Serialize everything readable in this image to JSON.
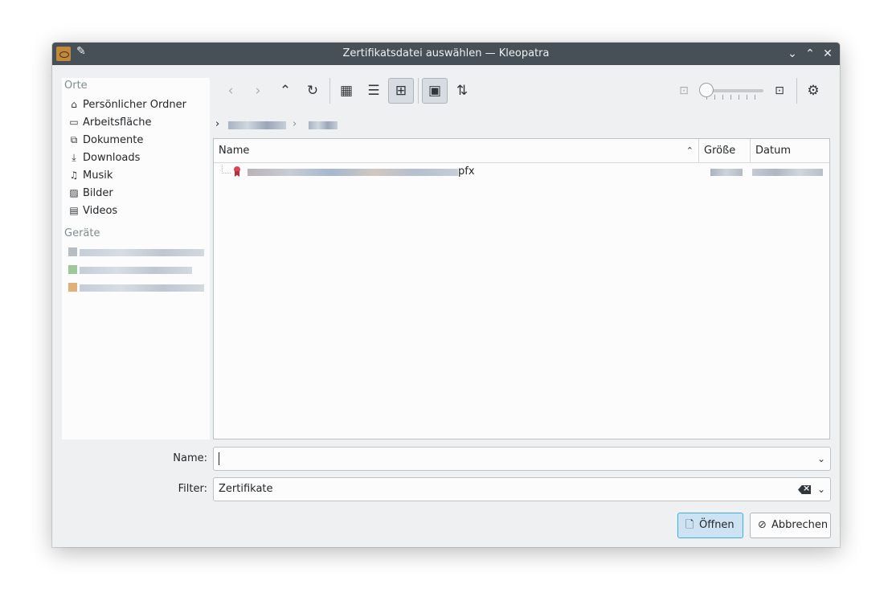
{
  "window": {
    "title": "Zertifikatsdatei auswählen — Kleopatra",
    "controls": {
      "minimize": "⌄",
      "maximize": "⌃",
      "close": "✕"
    }
  },
  "sidebar": {
    "places_header": "Orte",
    "places": [
      {
        "label": "Persönlicher Ordner",
        "icon": "home-icon",
        "glyph": "⌂"
      },
      {
        "label": "Arbeitsfläche",
        "icon": "desktop-icon",
        "glyph": "▭"
      },
      {
        "label": "Dokumente",
        "icon": "documents-icon",
        "glyph": "⧉"
      },
      {
        "label": "Downloads",
        "icon": "download-icon",
        "glyph": "⤓"
      },
      {
        "label": "Musik",
        "icon": "music-icon",
        "glyph": "♫"
      },
      {
        "label": "Bilder",
        "icon": "pictures-icon",
        "glyph": "▨"
      },
      {
        "label": "Videos",
        "icon": "video-icon",
        "glyph": "▤"
      }
    ],
    "devices_header": "Geräte"
  },
  "toolbar": {
    "buttons": [
      {
        "name": "back-button",
        "glyph": "‹",
        "enabled": false
      },
      {
        "name": "forward-button",
        "glyph": "›",
        "enabled": false
      },
      {
        "name": "parent-folder-button",
        "glyph": "⌃",
        "enabled": true
      },
      {
        "name": "reload-button",
        "glyph": "↻",
        "enabled": true
      },
      {
        "name": "icon-view-button",
        "glyph": "▦",
        "enabled": true
      },
      {
        "name": "compact-view-button",
        "glyph": "☰",
        "enabled": true
      },
      {
        "name": "tree-view-button",
        "glyph": "⊞",
        "enabled": true,
        "active": true
      },
      {
        "name": "preview-button",
        "glyph": "▣",
        "enabled": true,
        "active": true
      },
      {
        "name": "sort-button",
        "glyph": "⇅",
        "enabled": true
      }
    ],
    "zoom_level": 0,
    "options_glyph": "⚙"
  },
  "breadcrumb": {
    "separator": "›"
  },
  "file_list": {
    "columns": [
      "Name",
      "Größe",
      "Datum"
    ],
    "sort_indicator": "⌃",
    "rows": [
      {
        "name_suffix": "pfx"
      }
    ]
  },
  "form": {
    "name_label": "Name:",
    "name_value": "",
    "filter_label": "Filter:",
    "filter_value": "Zertifikate"
  },
  "buttons": {
    "open": "Öffnen",
    "cancel": "Abbrechen"
  },
  "colors": {
    "titlebar": "#475057",
    "accent": "#3daee9",
    "cert_red": "#da4453"
  }
}
